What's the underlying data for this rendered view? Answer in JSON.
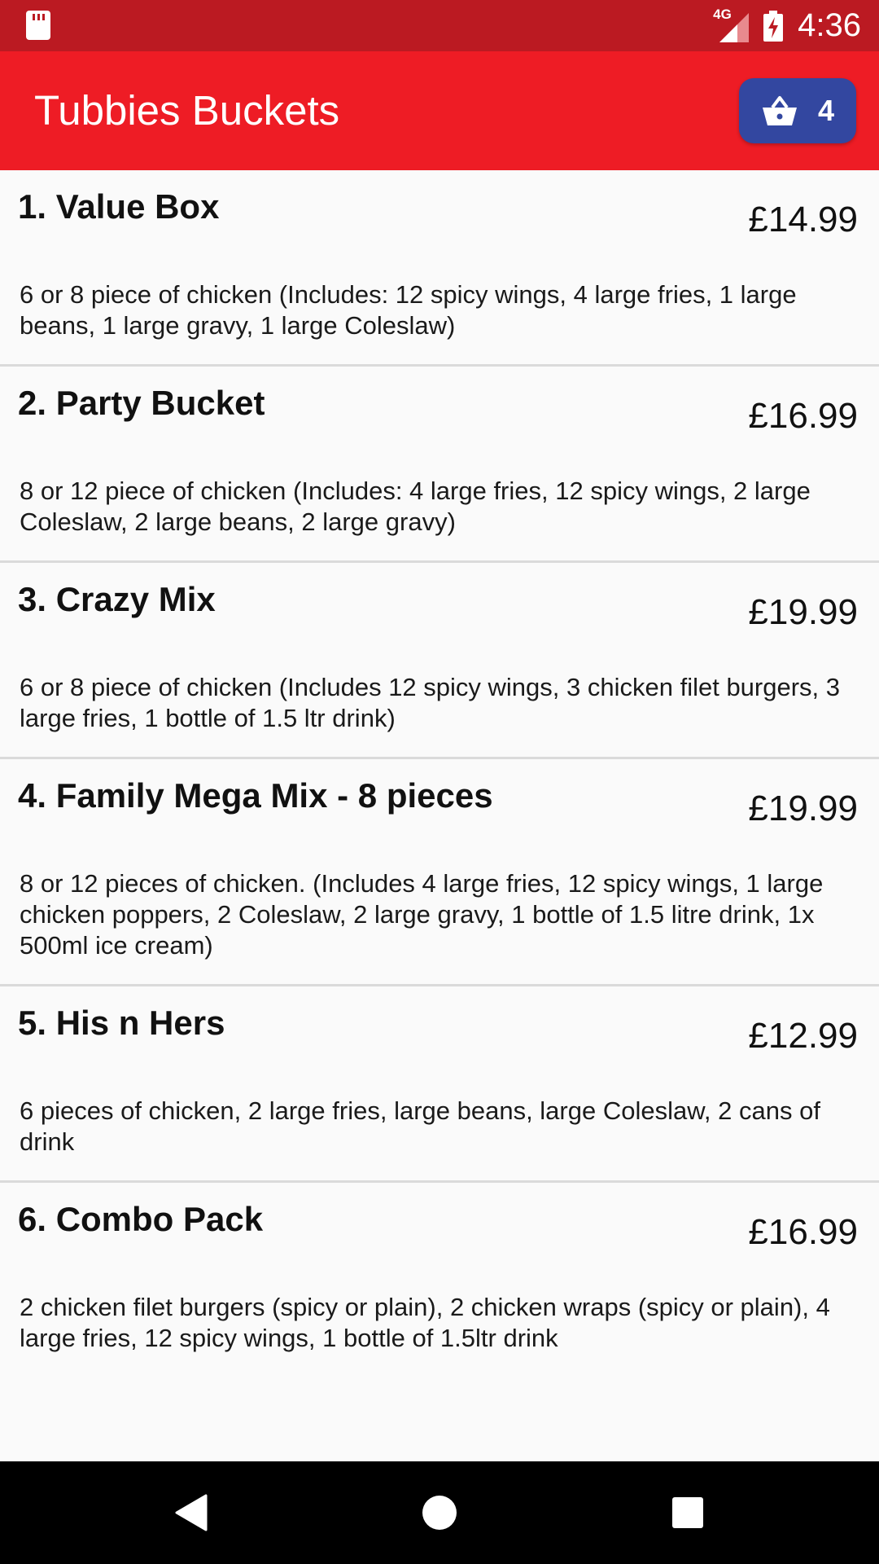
{
  "status_bar": {
    "network": "4G",
    "time": "4:36"
  },
  "app_bar": {
    "title": "Tubbies Buckets",
    "basket_count": "4"
  },
  "menu_items": [
    {
      "name": "1. Value Box",
      "price": "£14.99",
      "description": "6 or 8 piece of chicken (Includes: 12 spicy wings, 4 large fries, 1 large beans, 1 large gravy, 1 large Coleslaw)"
    },
    {
      "name": "2. Party Bucket",
      "price": "£16.99",
      "description": "8 or 12 piece of chicken (Includes: 4 large fries, 12 spicy wings, 2 large Coleslaw, 2 large beans, 2 large gravy)"
    },
    {
      "name": "3. Crazy Mix",
      "price": "£19.99",
      "description": "6 or 8 piece of chicken (Includes 12 spicy wings, 3 chicken filet burgers, 3 large fries, 1 bottle of 1.5 ltr drink)"
    },
    {
      "name": "4. Family Mega Mix - 8 pieces",
      "price": "£19.99",
      "description": "8 or 12 pieces of chicken. (Includes 4 large fries, 12 spicy wings, 1 large chicken poppers, 2 Coleslaw, 2 large gravy, 1 bottle of 1.5 litre drink, 1x 500ml ice cream)"
    },
    {
      "name": "5. His n Hers",
      "price": "£12.99",
      "description": "6 pieces of chicken, 2 large fries, large beans, large Coleslaw, 2 cans of drink"
    },
    {
      "name": "6. Combo Pack",
      "price": "£16.99",
      "description": "2 chicken filet burgers (spicy or plain), 2 chicken wraps (spicy or plain), 4 large fries, 12 spicy wings, 1 bottle of 1.5ltr drink"
    }
  ],
  "colors": {
    "status_bar": "#bb1a22",
    "app_bar": "#ee1c25",
    "basket_button": "#3347a0",
    "background": "#fafafa"
  },
  "icons": {
    "status_left": "sd-card-icon",
    "signal": "signal-icon",
    "battery": "battery-charging-icon",
    "basket": "basket-icon",
    "nav_back": "back-icon",
    "nav_home": "home-icon",
    "nav_recent": "recent-apps-icon"
  }
}
